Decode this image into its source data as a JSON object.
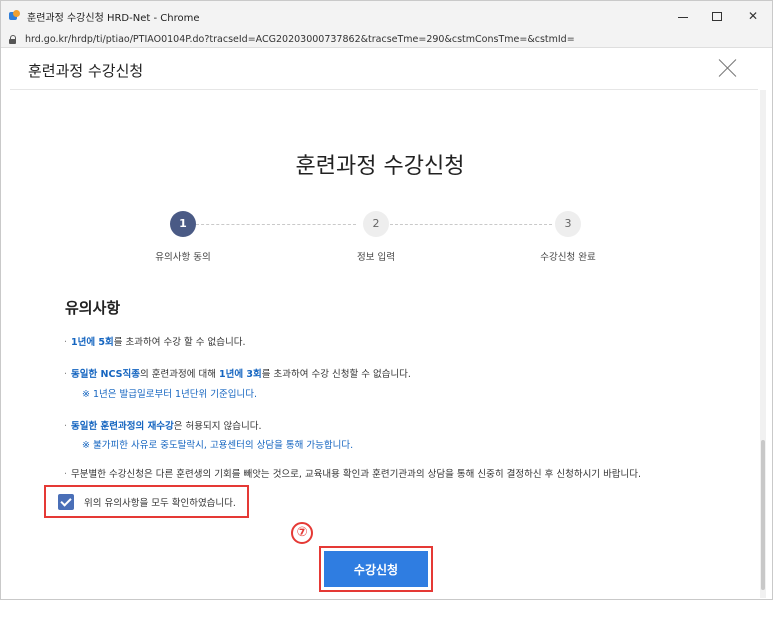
{
  "window": {
    "title": "훈련과정 수강신청 HRD-Net - Chrome",
    "url": "hrd.go.kr/hrdp/ti/ptiao/PTIAO0104P.do?tracseId=ACG20203000737862&tracseTme=290&cstmConsTme=&cstmId="
  },
  "modal": {
    "title": "훈련과정 수강신청"
  },
  "page": {
    "title": "훈련과정 수강신청"
  },
  "steps": [
    {
      "number": "1",
      "label": "유의사항 동의",
      "active": true
    },
    {
      "number": "2",
      "label": "정보 입력",
      "active": false
    },
    {
      "number": "3",
      "label": "수강신청 완료",
      "active": false
    }
  ],
  "notices": {
    "title": "유의사항",
    "n1": {
      "a": "1년에 5회",
      "b": "를 초과하여 수강 할 수 없습니다."
    },
    "n2": {
      "a": "동일한 NCS직종",
      "b": "의 훈련과정에 대해 ",
      "c": "1년에 3회",
      "d": "를 초과하여 수강 신청할 수 없습니다.",
      "sub": "※ 1년은 발급일로부터 1년단위 기준입니다."
    },
    "n3": {
      "a": "동일한 훈련과정의 재수강",
      "b": "은 허용되지 않습니다.",
      "sub": "※ 불가피한 사유로 중도탈락시, 고용센터의 상담을 통해 가능합니다."
    },
    "n4": {
      "a": "무분별한 수강신청은 다른 훈련생의 기회를 빼앗는 것으로, 교육내용 확인과 훈련기관과의 상담을 통해 신중히 결정하신 후 신청하시기 바랍니다."
    }
  },
  "agree": {
    "label": "위의 유의사항을 모두 확인하였습니다.",
    "checked": true
  },
  "annotation": {
    "step_marker": "⑦"
  },
  "submit": {
    "label": "수강신청"
  },
  "colors": {
    "accent": "#2f7de1",
    "highlight_text": "#1565c0",
    "annotation_red": "#e53935",
    "step_active": "#4a5a85"
  }
}
